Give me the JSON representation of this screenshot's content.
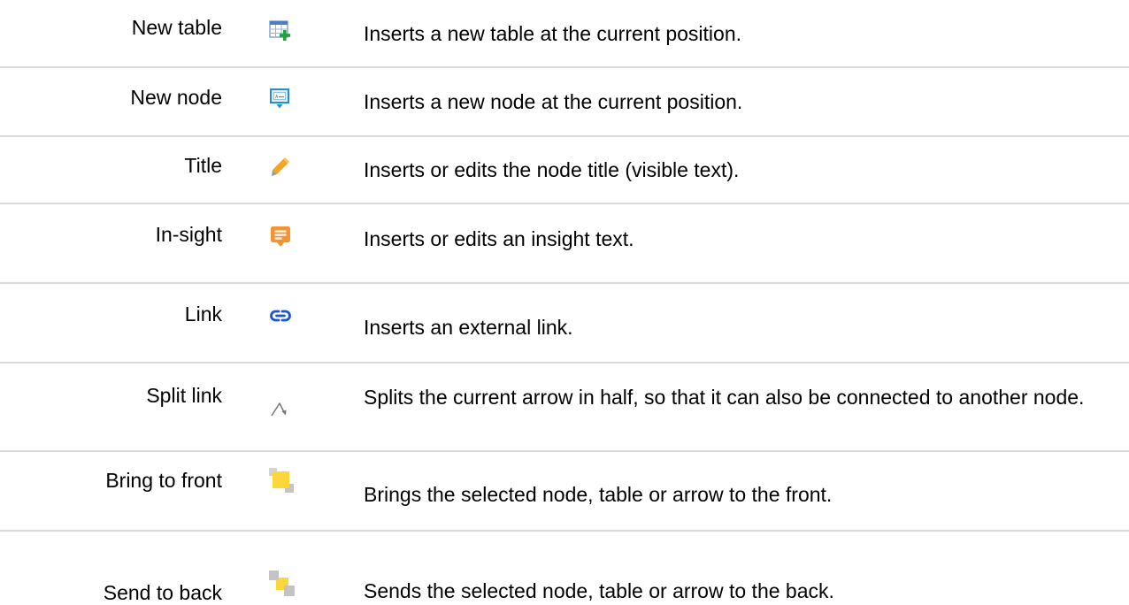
{
  "rows": [
    {
      "label": "New table",
      "icon": "table-add-icon",
      "description": "Inserts a new table at the current position."
    },
    {
      "label": "New node",
      "icon": "node-add-icon",
      "description": "Inserts a new node at the current position."
    },
    {
      "label": "Title",
      "icon": "pencil-icon",
      "description": "Inserts or edits the node title (visible text)."
    },
    {
      "label": "In-sight",
      "icon": "comment-icon",
      "description": "Inserts or edits an insight text."
    },
    {
      "label": "Link",
      "icon": "link-icon",
      "description": "Inserts an external link."
    },
    {
      "label": "Split link",
      "icon": "split-arrow-icon",
      "description": "Splits the current arrow in half, so that it can also be connected to another node."
    },
    {
      "label": "Bring to front",
      "icon": "bring-to-front-icon",
      "description": "Brings the selected node, table or arrow to the front."
    },
    {
      "label": "Send to back",
      "icon": "send-to-back-icon",
      "description": "Sends the selected node, table or arrow to the back."
    }
  ],
  "colors": {
    "divider": "#d9d9d9",
    "link_icon": "#1a55d6",
    "pencil_icon": "#f4a523",
    "comment_icon": "#f59331",
    "node_icon": "#2a8ccf",
    "table_add_icon": "#1fa03a",
    "layer_front": "#fcd63a",
    "layer_back": "#c4c4c4"
  }
}
